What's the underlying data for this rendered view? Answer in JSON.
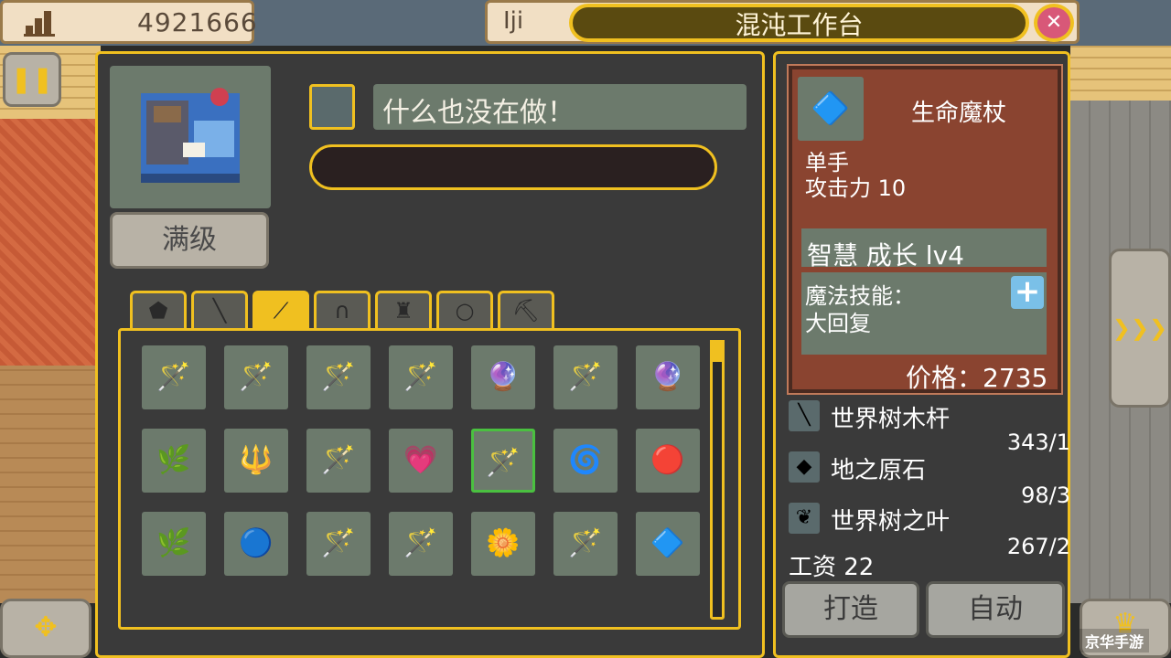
{
  "topbar": {
    "coins_icon": "stack-coins-icon",
    "coins": "4921666",
    "player_name": "Iji",
    "title": "混沌工作台",
    "close_icon": "close-icon"
  },
  "left_controls": {
    "pause_icon": "pause-icon",
    "move_icon": "move-arrows-icon"
  },
  "right_controls": {
    "next_icon": "fast-forward-icon",
    "crown_icon": "crown-icon"
  },
  "workbench": {
    "image": "crafting-table-sprite",
    "max_level_label": "满级"
  },
  "status": {
    "text": "什么也没在做！",
    "progress": 0
  },
  "tabs": [
    {
      "icon": "shield-icon"
    },
    {
      "icon": "sword-icon"
    },
    {
      "icon": "wand-icon",
      "active": true
    },
    {
      "icon": "helmet-icon"
    },
    {
      "icon": "armor-icon"
    },
    {
      "icon": "ring-icon"
    },
    {
      "icon": "pickaxe-icon"
    }
  ],
  "items": [
    "🪄",
    "🪄",
    "🪄",
    "🪄",
    "🔮",
    "🪄",
    "🔮",
    "🌿",
    "🔱",
    "🪄",
    "💗",
    "🪄",
    "🌀",
    "🔴",
    "🌿",
    "🔵",
    "🪄",
    "🪄",
    "🌼",
    "🪄",
    "🔷",
    "💗",
    "🔥",
    "🔮",
    "🔷",
    "❄",
    "⭐",
    "🔮"
  ],
  "selected_index": 11,
  "detail": {
    "icon": "ice-wand-icon",
    "name": "生命魔杖",
    "hand": "单手",
    "attack": "攻击力 10",
    "growth": "智慧 成长 lv4",
    "skill_label": "魔法技能：",
    "skill_name": "大回复",
    "price": "价格：2735"
  },
  "materials": [
    {
      "icon": "staff-icon",
      "name": "世界树木杆",
      "count": "343/1"
    },
    {
      "icon": "crystal-icon",
      "name": "地之原石",
      "count": "98/3"
    },
    {
      "icon": "leaf-icon",
      "name": "世界树之叶",
      "count": "267/2"
    }
  ],
  "wage": "工资 22",
  "buttons": {
    "craft": "打造",
    "auto": "自动"
  },
  "watermark": "京华手游"
}
